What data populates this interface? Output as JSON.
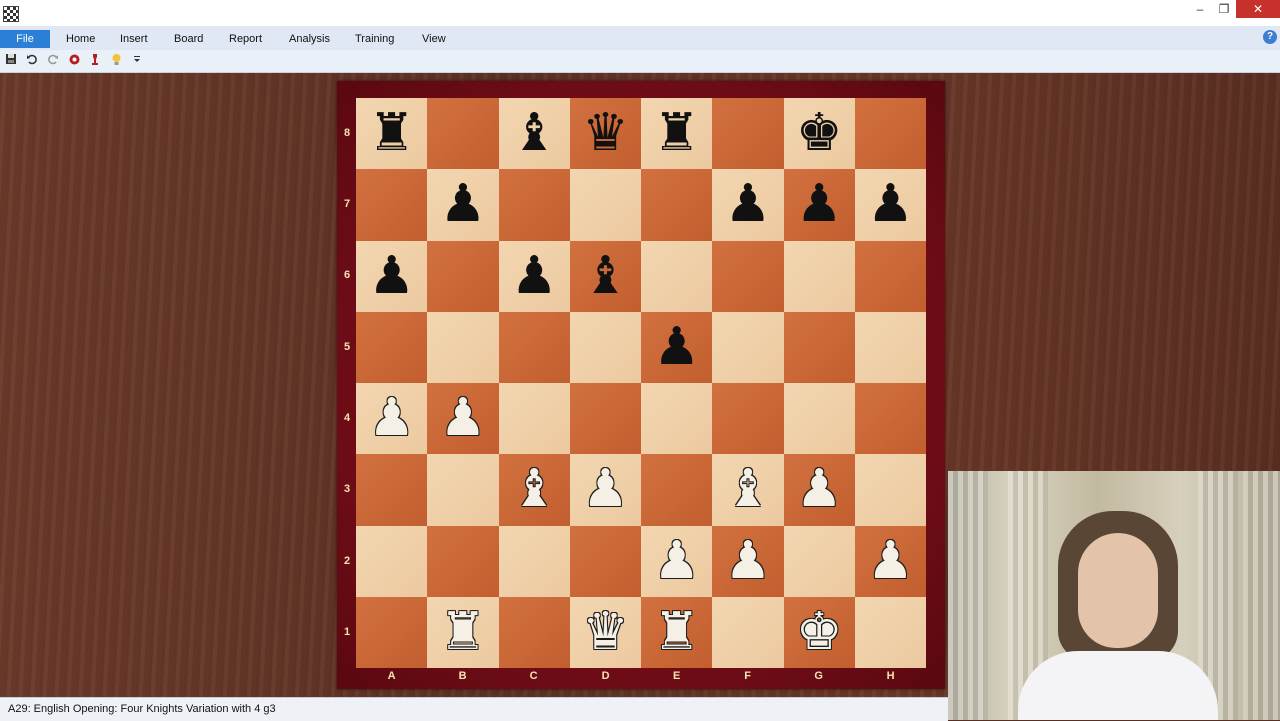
{
  "window": {
    "controls": {
      "minimize": "–",
      "maximize": "❐",
      "close": "✕"
    }
  },
  "menu": {
    "file": "File",
    "items": [
      "Home",
      "Insert",
      "Board",
      "Report",
      "Analysis",
      "Training",
      "View"
    ],
    "help_icon": "?"
  },
  "toolbar": {
    "icons": [
      "save-icon",
      "undo-icon",
      "redo-icon",
      "engine-icon",
      "piece-icon",
      "bulb-icon",
      "dropdown-icon"
    ]
  },
  "board": {
    "ranks": [
      "8",
      "7",
      "6",
      "5",
      "4",
      "3",
      "2",
      "1"
    ],
    "files": [
      "A",
      "B",
      "C",
      "D",
      "E",
      "F",
      "G",
      "H"
    ],
    "position": [
      [
        "r",
        "",
        "b",
        "q",
        "r",
        "",
        "k",
        ""
      ],
      [
        "",
        "p",
        "",
        "",
        "",
        "p",
        "p",
        "p"
      ],
      [
        "p",
        "",
        "p",
        "b",
        "",
        "",
        "",
        ""
      ],
      [
        "",
        "",
        "",
        "",
        "p",
        "",
        "",
        ""
      ],
      [
        "P",
        "P",
        "",
        "",
        "",
        "",
        "",
        ""
      ],
      [
        "",
        "",
        "B",
        "P",
        "",
        "B",
        "P",
        ""
      ],
      [
        "",
        "",
        "",
        "",
        "P",
        "P",
        "",
        "P"
      ],
      [
        "",
        "R",
        "",
        "Q",
        "R",
        "",
        "K",
        ""
      ]
    ],
    "colors": {
      "light": "#f0d3ab",
      "dark": "#cb6a38",
      "frame": "#7a0f19"
    }
  },
  "status": {
    "text": "A29: English Opening: Four Knights Variation with 4 g3"
  }
}
